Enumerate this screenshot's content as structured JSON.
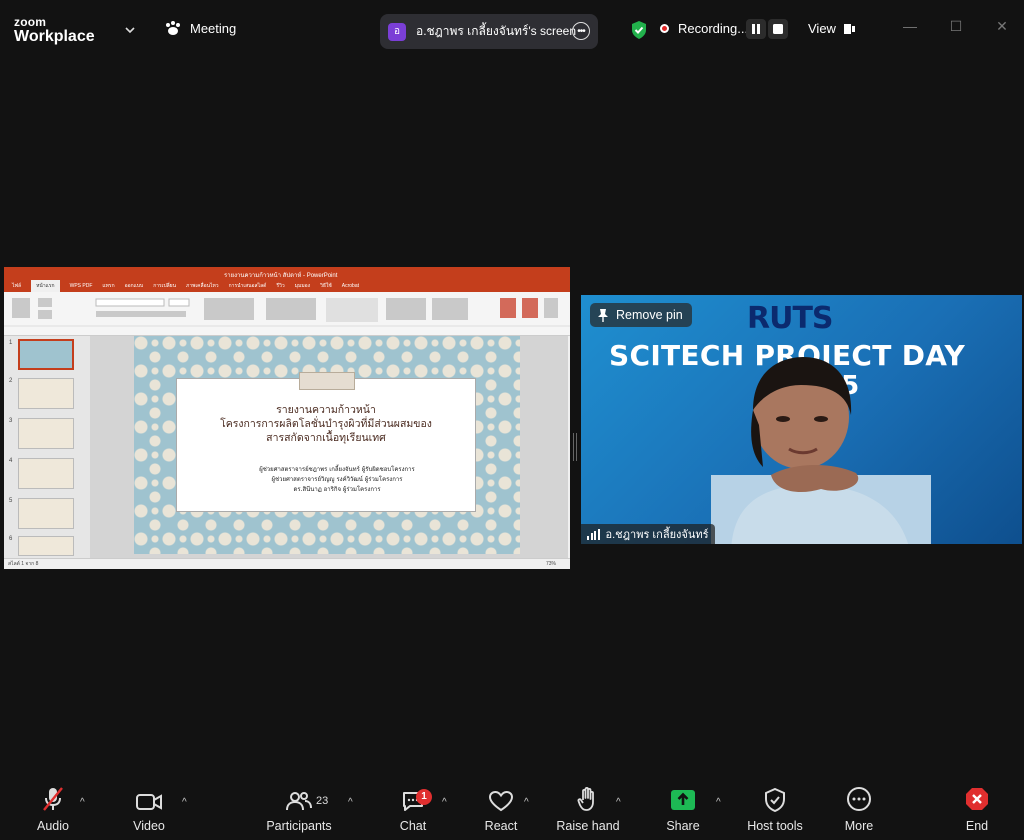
{
  "app": {
    "logo_line1": "zoom",
    "logo_line2": "Workplace"
  },
  "header": {
    "meeting_label": "Meeting",
    "screen_share_avatar": "อ",
    "screen_share_label": "อ.ชฎาพร  เกลี้ยงจันทร์'s screen",
    "recording_label": "Recording...",
    "view_label": "View"
  },
  "shared_screen": {
    "app_title": "รายงานความก้าวหน้า สัปดาห์ - PowerPoint",
    "ribbon_tabs": [
      "ไฟล์",
      "หน้าแรก",
      "WPS PDF",
      "แทรก",
      "ออกแบบ",
      "การเปลี่ยน",
      "ภาพเคลื่อนไหว",
      "การนำเสนอสไลด์",
      "รีวิว",
      "มุมมอง",
      "วิธีใช้",
      "Acrobat"
    ],
    "active_tab": "หน้าแรก",
    "thumb_numbers": [
      "1",
      "2",
      "3",
      "4",
      "5",
      "6"
    ],
    "slide": {
      "title_line1": "รายงานความก้าวหน้า",
      "title_line2": "โครงการการผลิตโลชั่นบำรุงผิวที่มีส่วนผสมของ",
      "title_line3": "สารสกัดจากเนื้อทุเรียนเทศ",
      "name1": "ผู้ช่วยศาสตราจารย์ชฎาพร  เกลี้ยงจันทร์ ผู้รับผิดชอบโครงการ",
      "name2": "ผู้ช่วยศาสตราจารย์วิญญู  รงค์วิวัฒน์   ผู้ร่วมโครงการ",
      "name3": "ดร.สินีนาฏ  อาริกิจ        ผู้ร่วมโครงการ"
    },
    "status_left": "สไลด์ 1 จาก 8",
    "zoom_level": "73%"
  },
  "video": {
    "remove_pin_label": "Remove pin",
    "banner_logo": "RUTS",
    "banner_title": "SCITECH PROJECT DAY",
    "banner_year": "25",
    "participant_name": "อ.ชฎาพร  เกลี้ยงจันทร์"
  },
  "toolbar": {
    "audio": "Audio",
    "video": "Video",
    "participants": "Participants",
    "participants_count": "23",
    "chat": "Chat",
    "chat_badge": "1",
    "react": "React",
    "raise_hand": "Raise hand",
    "share": "Share",
    "host_tools": "Host tools",
    "more": "More",
    "end": "End"
  },
  "colors": {
    "background": "#121212",
    "share_green": "#1db954",
    "end_red": "#e02f2f",
    "recording_red": "#e02828",
    "ppt_orange": "#c43e1c"
  }
}
